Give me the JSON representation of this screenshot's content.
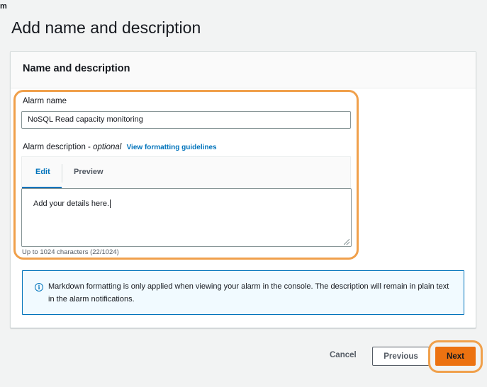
{
  "breadcrumb": "m",
  "page_title": "Add name and description",
  "section": {
    "title": "Name and description",
    "alarm_name_label": "Alarm name",
    "alarm_name_value": "NoSQL Read capacity monitoring",
    "description_label": "Alarm description - ",
    "description_optional": "optional",
    "formatting_link": "View formatting guidelines",
    "tabs": [
      "Edit",
      "Preview"
    ],
    "description_text": "Add your details here.",
    "char_counter": "Up to 1024 characters (22/1024)"
  },
  "info": {
    "icon": "info-icon",
    "text": "Markdown formatting is only applied when viewing your alarm in the console. The description will remain in plain text in the alarm notifications."
  },
  "footer": {
    "cancel": "Cancel",
    "previous": "Previous",
    "next": "Next"
  },
  "colors": {
    "primary": "#ec7211",
    "link": "#0073bb",
    "highlight": "#f0a04b"
  }
}
